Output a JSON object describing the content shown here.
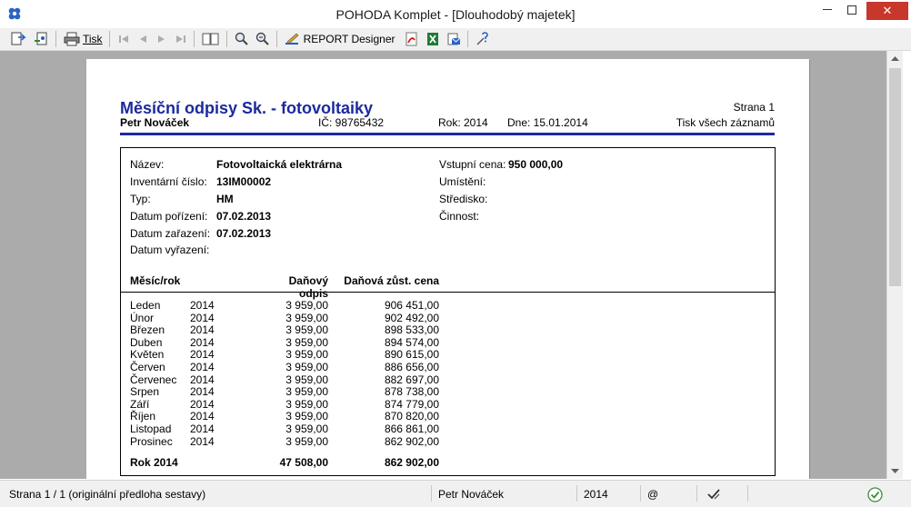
{
  "window": {
    "title": "POHODA Komplet - [Dlouhodobý majetek]",
    "close_glyph": "✕",
    "minimize_glyph": "—",
    "maximize_glyph": "☐"
  },
  "toolbar": {
    "print_label": "Tisk",
    "report_designer_label": "REPORT Designer",
    "icons": [
      "page-setup-icon",
      "export-icon",
      "print-icon",
      "first-page-icon",
      "prev-page-icon",
      "next-page-icon",
      "last-page-icon",
      "two-pages-icon",
      "zoom-in-icon",
      "zoom-out-icon",
      "report-designer-icon",
      "pdf-icon",
      "excel-icon",
      "email-icon",
      "help-icon"
    ]
  },
  "report": {
    "title": "Měsíční odpisy Sk. - fotovoltaiky",
    "page_label": "Strana 1",
    "author": "Petr Nováček",
    "ic": "IČ: 98765432",
    "year": "Rok: 2014",
    "date": "Dne: 15.01.2014",
    "scope": "Tisk všech záznamů",
    "accent_color": "#1b2a9c",
    "fields_left": [
      {
        "label": "Název:",
        "value": "Fotovoltaická elektrárna"
      },
      {
        "label": "Inventární číslo:",
        "value": "13IM00002"
      },
      {
        "label": "Typ:",
        "value": "HM"
      },
      {
        "label": "Datum pořízení:",
        "value": "07.02.2013"
      },
      {
        "label": "Datum zařazení:",
        "value": "07.02.2013"
      },
      {
        "label": "Datum vyřazení:",
        "value": ""
      }
    ],
    "fields_right": [
      {
        "label": "Vstupní cena:",
        "value": "950 000,00"
      },
      {
        "label": "Umístění:",
        "value": ""
      },
      {
        "label": "Středisko:",
        "value": ""
      },
      {
        "label": "Činnost:",
        "value": ""
      }
    ],
    "columns": {
      "month": "Měsíc/rok",
      "odpis": "Daňový odpis",
      "cena": "Daňová zůst. cena"
    },
    "rows": [
      {
        "month": "Leden",
        "year": "2014",
        "odpis": "3 959,00",
        "cena": "906 451,00"
      },
      {
        "month": "Únor",
        "year": "2014",
        "odpis": "3 959,00",
        "cena": "902 492,00"
      },
      {
        "month": "Březen",
        "year": "2014",
        "odpis": "3 959,00",
        "cena": "898 533,00"
      },
      {
        "month": "Duben",
        "year": "2014",
        "odpis": "3 959,00",
        "cena": "894 574,00"
      },
      {
        "month": "Květen",
        "year": "2014",
        "odpis": "3 959,00",
        "cena": "890 615,00"
      },
      {
        "month": "Červen",
        "year": "2014",
        "odpis": "3 959,00",
        "cena": "886 656,00"
      },
      {
        "month": "Červenec",
        "year": "2014",
        "odpis": "3 959,00",
        "cena": "882 697,00"
      },
      {
        "month": "Srpen",
        "year": "2014",
        "odpis": "3 959,00",
        "cena": "878 738,00"
      },
      {
        "month": "Září",
        "year": "2014",
        "odpis": "3 959,00",
        "cena": "874 779,00"
      },
      {
        "month": "Říjen",
        "year": "2014",
        "odpis": "3 959,00",
        "cena": "870 820,00"
      },
      {
        "month": "Listopad",
        "year": "2014",
        "odpis": "3 959,00",
        "cena": "866 861,00"
      },
      {
        "month": "Prosinec",
        "year": "2014",
        "odpis": "3 959,00",
        "cena": "862 902,00"
      }
    ],
    "total": {
      "label": "Rok 2014",
      "odpis": "47 508,00",
      "cena": "862 902,00"
    }
  },
  "statusbar": {
    "page_info": "Strana 1 / 1  (originální předloha sestavy)",
    "user": "Petr Nováček",
    "year": "2014",
    "at_symbol": "@",
    "check_glyph": "✔"
  }
}
